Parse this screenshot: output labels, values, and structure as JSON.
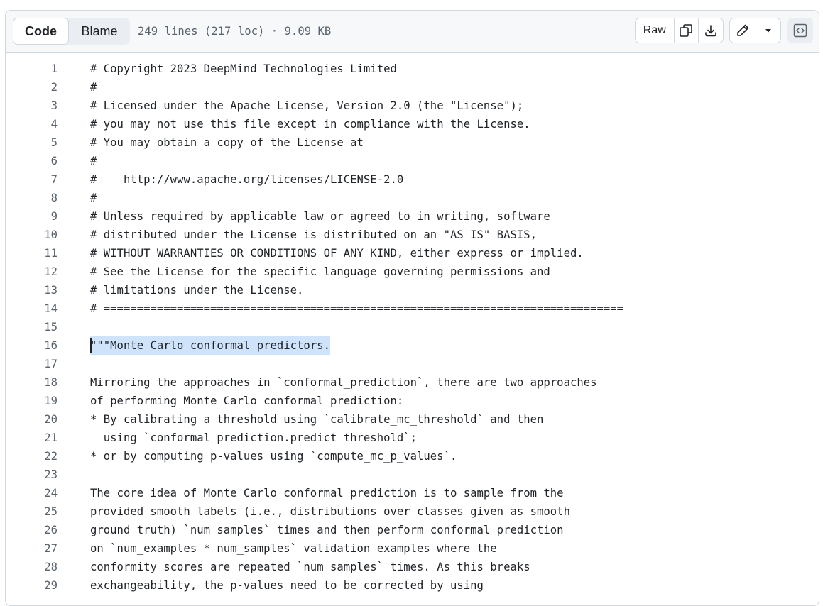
{
  "toolbar": {
    "code_label": "Code",
    "blame_label": "Blame",
    "file_meta": "249 lines (217 loc) · 9.09 KB",
    "raw_label": "Raw",
    "icons": {
      "copy": "copy-icon",
      "download": "download-icon",
      "edit": "pencil-icon",
      "dropdown": "triangle-down-icon",
      "symbols": "code-square-icon"
    }
  },
  "code": {
    "selected_line": 16,
    "lines": [
      {
        "n": "1",
        "t": "# Copyright 2023 DeepMind Technologies Limited"
      },
      {
        "n": "2",
        "t": "#"
      },
      {
        "n": "3",
        "t": "# Licensed under the Apache License, Version 2.0 (the \"License\");"
      },
      {
        "n": "4",
        "t": "# you may not use this file except in compliance with the License."
      },
      {
        "n": "5",
        "t": "# You may obtain a copy of the License at"
      },
      {
        "n": "6",
        "t": "#"
      },
      {
        "n": "7",
        "t": "#    http://www.apache.org/licenses/LICENSE-2.0"
      },
      {
        "n": "8",
        "t": "#"
      },
      {
        "n": "9",
        "t": "# Unless required by applicable law or agreed to in writing, software"
      },
      {
        "n": "10",
        "t": "# distributed under the License is distributed on an \"AS IS\" BASIS,"
      },
      {
        "n": "11",
        "t": "# WITHOUT WARRANTIES OR CONDITIONS OF ANY KIND, either express or implied."
      },
      {
        "n": "12",
        "t": "# See the License for the specific language governing permissions and"
      },
      {
        "n": "13",
        "t": "# limitations under the License."
      },
      {
        "n": "14",
        "t": "# =============================================================================="
      },
      {
        "n": "15",
        "t": ""
      },
      {
        "n": "16",
        "t": "\"\"\"Monte Carlo conformal predictors."
      },
      {
        "n": "17",
        "t": ""
      },
      {
        "n": "18",
        "t": "Mirroring the approaches in `conformal_prediction`, there are two approaches"
      },
      {
        "n": "19",
        "t": "of performing Monte Carlo conformal prediction:"
      },
      {
        "n": "20",
        "t": "* By calibrating a threshold using `calibrate_mc_threshold` and then"
      },
      {
        "n": "21",
        "t": "  using `conformal_prediction.predict_threshold`;"
      },
      {
        "n": "22",
        "t": "* or by computing p-values using `compute_mc_p_values`."
      },
      {
        "n": "23",
        "t": ""
      },
      {
        "n": "24",
        "t": "The core idea of Monte Carlo conformal prediction is to sample from the"
      },
      {
        "n": "25",
        "t": "provided smooth labels (i.e., distributions over classes given as smooth"
      },
      {
        "n": "26",
        "t": "ground truth) `num_samples` times and then perform conformal prediction"
      },
      {
        "n": "27",
        "t": "on `num_examples * num_samples` validation examples where the"
      },
      {
        "n": "28",
        "t": "conformity scores are repeated `num_samples` times. As this breaks"
      },
      {
        "n": "29",
        "t": "exchangeability, the p-values need to be corrected by using"
      }
    ]
  }
}
